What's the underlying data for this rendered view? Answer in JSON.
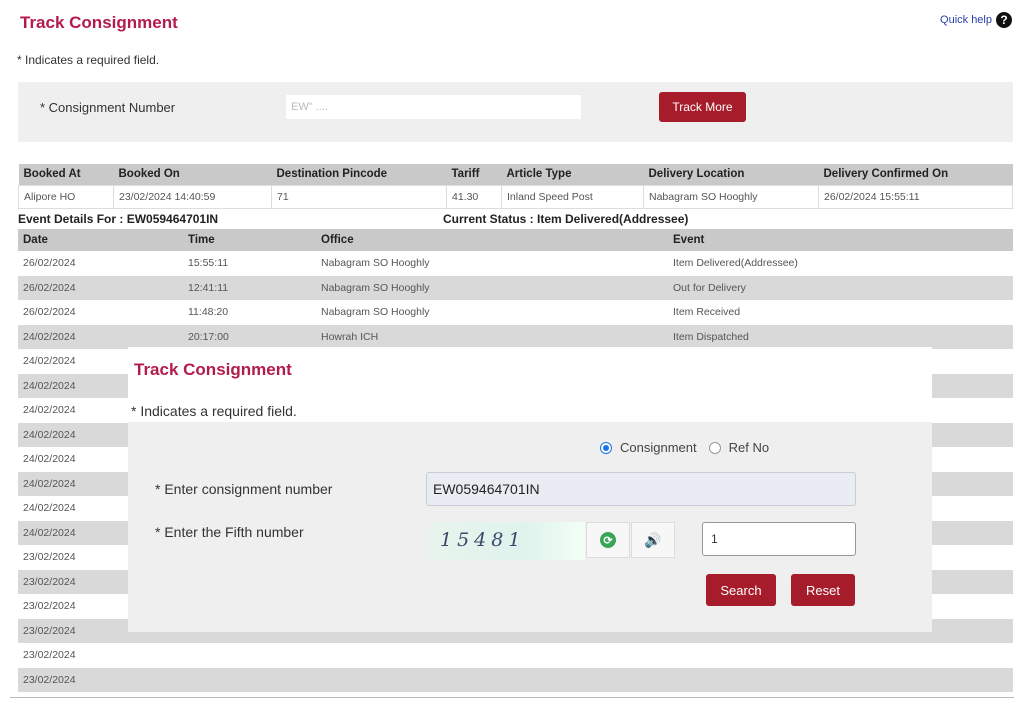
{
  "page": {
    "title": "Track Consignment",
    "quick_help": "Quick help",
    "required_note": "* Indicates a required field."
  },
  "top_form": {
    "label": "* Consignment Number",
    "input_value": "EW\"  ....",
    "button": "Track More"
  },
  "summary": {
    "headers": [
      "Booked At",
      "Booked On",
      "Destination Pincode",
      "Tariff",
      "Article Type",
      "Delivery Location",
      "Delivery Confirmed On"
    ],
    "row": [
      "Alipore HO",
      "23/02/2024 14:40:59",
      "71",
      "41.30",
      "Inland Speed Post",
      "Nabagram SO Hooghly",
      "26/02/2024 15:55:11"
    ]
  },
  "event_details": {
    "label": "Event Details For : EW059464701IN",
    "status": "Current Status : Item Delivered(Addressee)"
  },
  "events": {
    "headers": [
      "Date",
      "Time",
      "Office",
      "Event"
    ],
    "rows": [
      [
        "26/02/2024",
        "15:55:11",
        "Nabagram SO Hooghly",
        "Item Delivered(Addressee)"
      ],
      [
        "26/02/2024",
        "12:41:11",
        "Nabagram SO Hooghly",
        "Out for Delivery"
      ],
      [
        "26/02/2024",
        "11:48:20",
        "Nabagram SO Hooghly",
        "Item Received"
      ],
      [
        "24/02/2024",
        "20:17:00",
        "Howrah ICH",
        "Item Dispatched"
      ],
      [
        "24/02/2024",
        "",
        "",
        ""
      ],
      [
        "24/02/2024",
        "",
        "",
        ""
      ],
      [
        "24/02/2024",
        "",
        "",
        ""
      ],
      [
        "24/02/2024",
        "",
        "",
        ""
      ],
      [
        "24/02/2024",
        "",
        "",
        ""
      ],
      [
        "24/02/2024",
        "",
        "",
        ""
      ],
      [
        "24/02/2024",
        "",
        "",
        ""
      ],
      [
        "24/02/2024",
        "",
        "",
        ""
      ],
      [
        "23/02/2024",
        "",
        "",
        ""
      ],
      [
        "23/02/2024",
        "",
        "",
        ""
      ],
      [
        "23/02/2024",
        "",
        "",
        ""
      ],
      [
        "23/02/2024",
        "",
        "",
        ""
      ],
      [
        "23/02/2024",
        "",
        "",
        ""
      ],
      [
        "23/02/2024",
        "",
        "",
        ""
      ]
    ]
  },
  "modal": {
    "title": "Track Consignment",
    "required_note": "* Indicates a required field.",
    "radio_consignment": "Consignment",
    "radio_ref": "Ref No",
    "consignment_label": "* Enter consignment number",
    "consignment_value": "EW059464701IN",
    "fifth_label": "* Enter the Fifth number",
    "captcha_text": "15481",
    "answer_value": "1",
    "search_button": "Search",
    "reset_button": "Reset"
  },
  "icons": {
    "help": "question-circle-icon",
    "refresh": "refresh-icon",
    "audio": "speaker-icon"
  },
  "colors": {
    "title": "#b31b4b",
    "button": "#a61c2a",
    "header_gray": "#c9c9c9"
  }
}
